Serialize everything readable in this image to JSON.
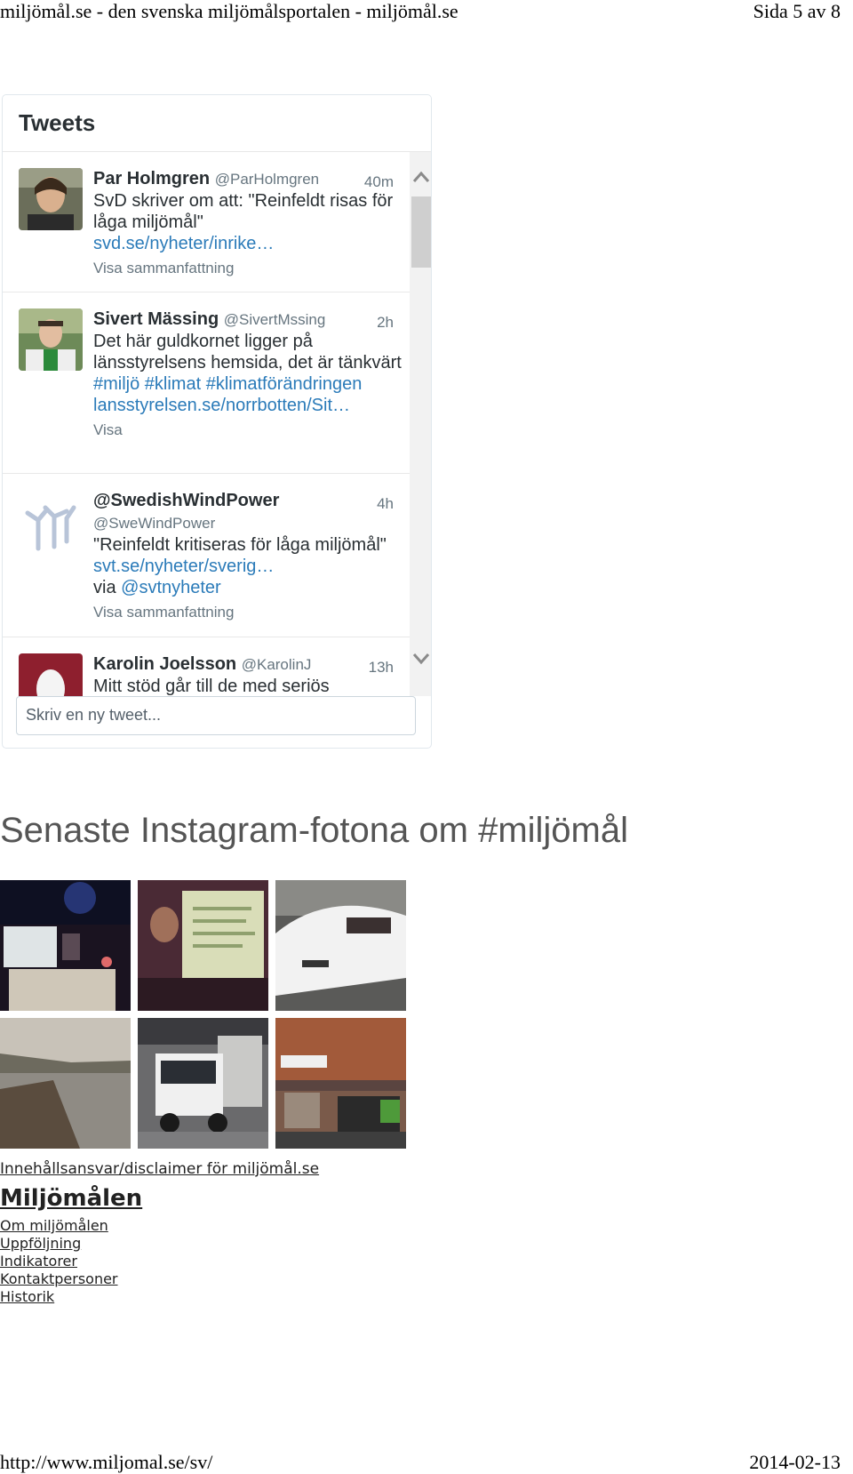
{
  "pdf": {
    "header_left": "miljömål.se - den svenska miljömålsportalen - miljömål.se",
    "header_right": "Sida 5 av 8",
    "footer_left": "http://www.miljomal.se/sv/",
    "footer_right": "2014-02-13"
  },
  "tweets_widget": {
    "title": "Tweets",
    "compose_placeholder": "Skriv en ny tweet...",
    "tweets": [
      {
        "name": "Par Holmgren",
        "handle": "@ParHolmgren",
        "time": "40m",
        "text": "SvD skriver om att: \"Reinfeldt risas för låga miljömål\"",
        "link": "svd.se/nyheter/inrike…",
        "expand": "Visa sammanfattning"
      },
      {
        "name": "Sivert Mässing",
        "handle": "@SivertMssing",
        "time": "2h",
        "text": "Det här guldkornet ligger på länsstyrelsens hemsida, det är tänkvärt",
        "hashtags": "#miljö #klimat #klimatförändringen",
        "link": "lansstyrelsen.se/norrbotten/Sit…",
        "expand": "Visa"
      },
      {
        "name": "@SwedishWindPower",
        "handle": "@SweWindPower",
        "time": "4h",
        "text": "\"Reinfeldt kritiseras för låga miljömål\"",
        "link": "svt.se/nyheter/sverig…",
        "via_prefix": "via",
        "via": "@svtnyheter",
        "expand": "Visa sammanfattning"
      },
      {
        "name": "Karolin Joelsson",
        "handle": "@KarolinJ",
        "time": "13h",
        "text": "Mitt stöd går till de med seriös"
      }
    ]
  },
  "instagram": {
    "title": "Senaste Instagram-fotona om #miljömål"
  },
  "footer_links": {
    "disclaimer": "Innehållsansvar/disclaimer för miljömål.se",
    "heading": "Miljömålen",
    "items": [
      "Om miljömålen",
      "Uppföljning",
      "Indikatorer",
      "Kontaktpersoner",
      "Historik"
    ]
  }
}
